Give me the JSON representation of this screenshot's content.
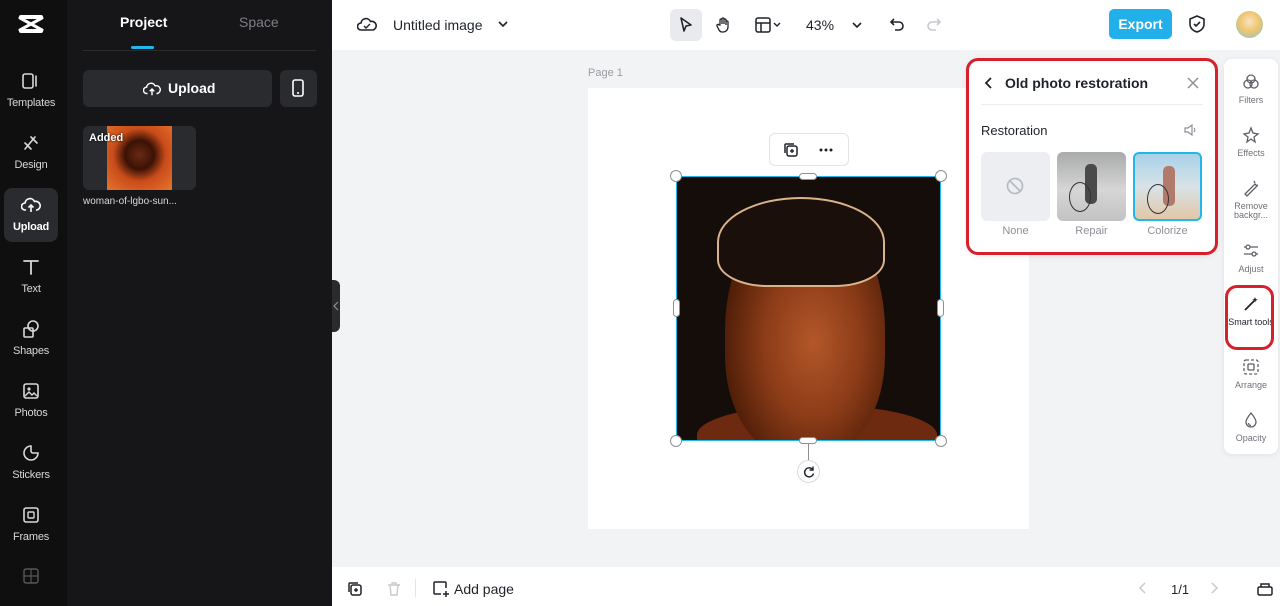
{
  "nav": {
    "items": [
      {
        "label": "Templates",
        "icon": "templates-icon"
      },
      {
        "label": "Design",
        "icon": "design-icon"
      },
      {
        "label": "Upload",
        "icon": "upload-icon"
      },
      {
        "label": "Text",
        "icon": "text-icon"
      },
      {
        "label": "Shapes",
        "icon": "shapes-icon"
      },
      {
        "label": "Photos",
        "icon": "photos-icon"
      },
      {
        "label": "Stickers",
        "icon": "stickers-icon"
      },
      {
        "label": "Frames",
        "icon": "frames-icon"
      }
    ],
    "active": "Upload"
  },
  "panel": {
    "tabs": [
      "Project",
      "Space"
    ],
    "upload_label": "Upload",
    "asset": {
      "badge": "Added",
      "name": "woman-of-lgbo-sun..."
    }
  },
  "topbar": {
    "title": "Untitled image",
    "zoom": "43%",
    "export_label": "Export"
  },
  "canvas": {
    "page_label": "Page 1"
  },
  "restoration": {
    "title": "Old photo restoration",
    "section": "Restoration",
    "options": [
      {
        "label": "None",
        "selected": false
      },
      {
        "label": "Repair",
        "selected": false
      },
      {
        "label": "Colorize",
        "selected": true
      }
    ]
  },
  "rightbar": {
    "items": [
      {
        "label": "Filters",
        "icon": "filters-icon"
      },
      {
        "label": "Effects",
        "icon": "effects-icon"
      },
      {
        "label": "Remove backgr...",
        "icon": "remove-background-icon"
      },
      {
        "label": "Adjust",
        "icon": "adjust-icon"
      },
      {
        "label": "Smart tools",
        "icon": "smart-tools-icon"
      },
      {
        "label": "Arrange",
        "icon": "arrange-icon"
      },
      {
        "label": "Opacity",
        "icon": "opacity-icon"
      }
    ]
  },
  "bottombar": {
    "add_page_label": "Add page",
    "pages": "1/1"
  },
  "colors": {
    "accent": "#21b7e8",
    "export": "#21b0ea",
    "highlight": "#d7202b"
  }
}
